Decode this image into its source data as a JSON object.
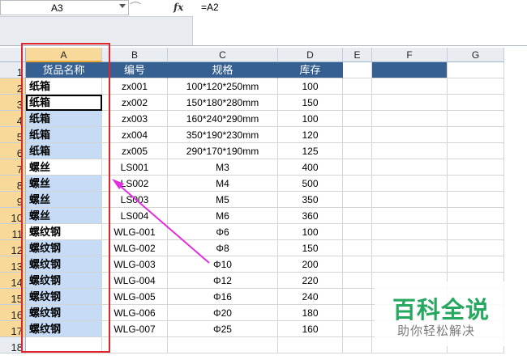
{
  "formula_bar": {
    "name_box": "A3",
    "fx_label": "fx",
    "formula": "=A2"
  },
  "columns": [
    "A",
    "B",
    "C",
    "D",
    "E",
    "F",
    "G"
  ],
  "rows": [
    "1",
    "2",
    "3",
    "4",
    "5",
    "6",
    "7",
    "8",
    "9",
    "10",
    "11",
    "12",
    "13",
    "14",
    "15",
    "16",
    "17",
    "18"
  ],
  "headers": {
    "a": "货品名称",
    "b": "编号",
    "c": "规格",
    "d": "库存"
  },
  "data_rows": [
    {
      "a": "纸箱",
      "b": "zx001",
      "c": "100*120*250mm",
      "d": "100",
      "blue": false
    },
    {
      "a": "纸箱",
      "b": "zx002",
      "c": "150*180*280mm",
      "d": "150",
      "blue": false
    },
    {
      "a": "纸箱",
      "b": "zx003",
      "c": "160*240*290mm",
      "d": "100",
      "blue": true
    },
    {
      "a": "纸箱",
      "b": "zx004",
      "c": "350*190*230mm",
      "d": "120",
      "blue": true
    },
    {
      "a": "纸箱",
      "b": "zx005",
      "c": "290*170*190mm",
      "d": "125",
      "blue": true
    },
    {
      "a": "螺丝",
      "b": "LS001",
      "c": "M3",
      "d": "400",
      "blue": false
    },
    {
      "a": "螺丝",
      "b": "LS002",
      "c": "M4",
      "d": "500",
      "blue": true
    },
    {
      "a": "螺丝",
      "b": "LS003",
      "c": "M5",
      "d": "350",
      "blue": true
    },
    {
      "a": "螺丝",
      "b": "LS004",
      "c": "M6",
      "d": "360",
      "blue": true
    },
    {
      "a": "螺纹钢",
      "b": "WLG-001",
      "c": "Φ6",
      "d": "100",
      "blue": false
    },
    {
      "a": "螺纹钢",
      "b": "WLG-002",
      "c": "Φ8",
      "d": "150",
      "blue": true
    },
    {
      "a": "螺纹钢",
      "b": "WLG-003",
      "c": "Φ10",
      "d": "200",
      "blue": true
    },
    {
      "a": "螺纹钢",
      "b": "WLG-004",
      "c": "Φ12",
      "d": "220",
      "blue": true
    },
    {
      "a": "螺纹钢",
      "b": "WLG-005",
      "c": "Φ16",
      "d": "240",
      "blue": true
    },
    {
      "a": "螺纹钢",
      "b": "WLG-006",
      "c": "Φ20",
      "d": "180",
      "blue": true
    },
    {
      "a": "螺纹钢",
      "b": "WLG-007",
      "c": "Φ25",
      "d": "160",
      "blue": true
    }
  ],
  "watermark": {
    "title": "百科全说",
    "subtitle": "助你轻松解决"
  },
  "colors": {
    "header_fill": "#366092",
    "selection_fill": "#c6dcf6",
    "annotation_red": "#e0262a",
    "arrow_magenta": "#e22ee0",
    "watermark_green": "#27a860"
  }
}
